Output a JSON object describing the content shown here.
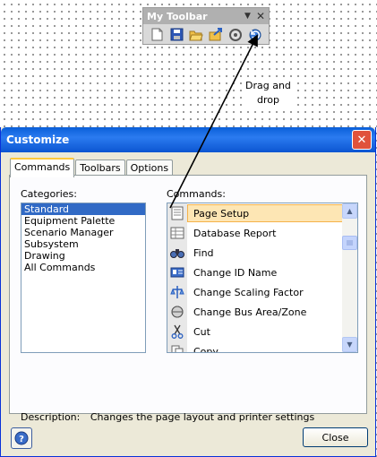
{
  "toolbar": {
    "title": "My Toolbar",
    "dropdown_glyph": "▼",
    "close_glyph": "✕",
    "icons": [
      "new-icon",
      "save-icon",
      "open-icon",
      "export-icon",
      "refresh-icon",
      "run-icon"
    ]
  },
  "drag_label": {
    "line1": "Drag and",
    "line2": "drop"
  },
  "dialog": {
    "title": "Customize",
    "close_glyph": "✕",
    "tabs": [
      "Commands",
      "Toolbars",
      "Options"
    ],
    "categories_label": "Categories:",
    "categories": [
      "Standard",
      "Equipment Palette",
      "Scenario Manager",
      "Subsystem",
      "Drawing",
      "All Commands"
    ],
    "commands_label": "Commands:",
    "commands": [
      "Page Setup",
      "Database Report",
      "Find",
      "Change ID Name",
      "Change Scaling Factor",
      "Change Bus Area/Zone",
      "Cut",
      "Copy"
    ],
    "description_label": "Description:",
    "description_text": "Changes the page layout and printer settings",
    "help_glyph": "?",
    "close_button": "Close"
  },
  "colors": {
    "title_bar": "#0a5fd8",
    "selection": "#316ac5",
    "highlight": "#fde6b4"
  }
}
